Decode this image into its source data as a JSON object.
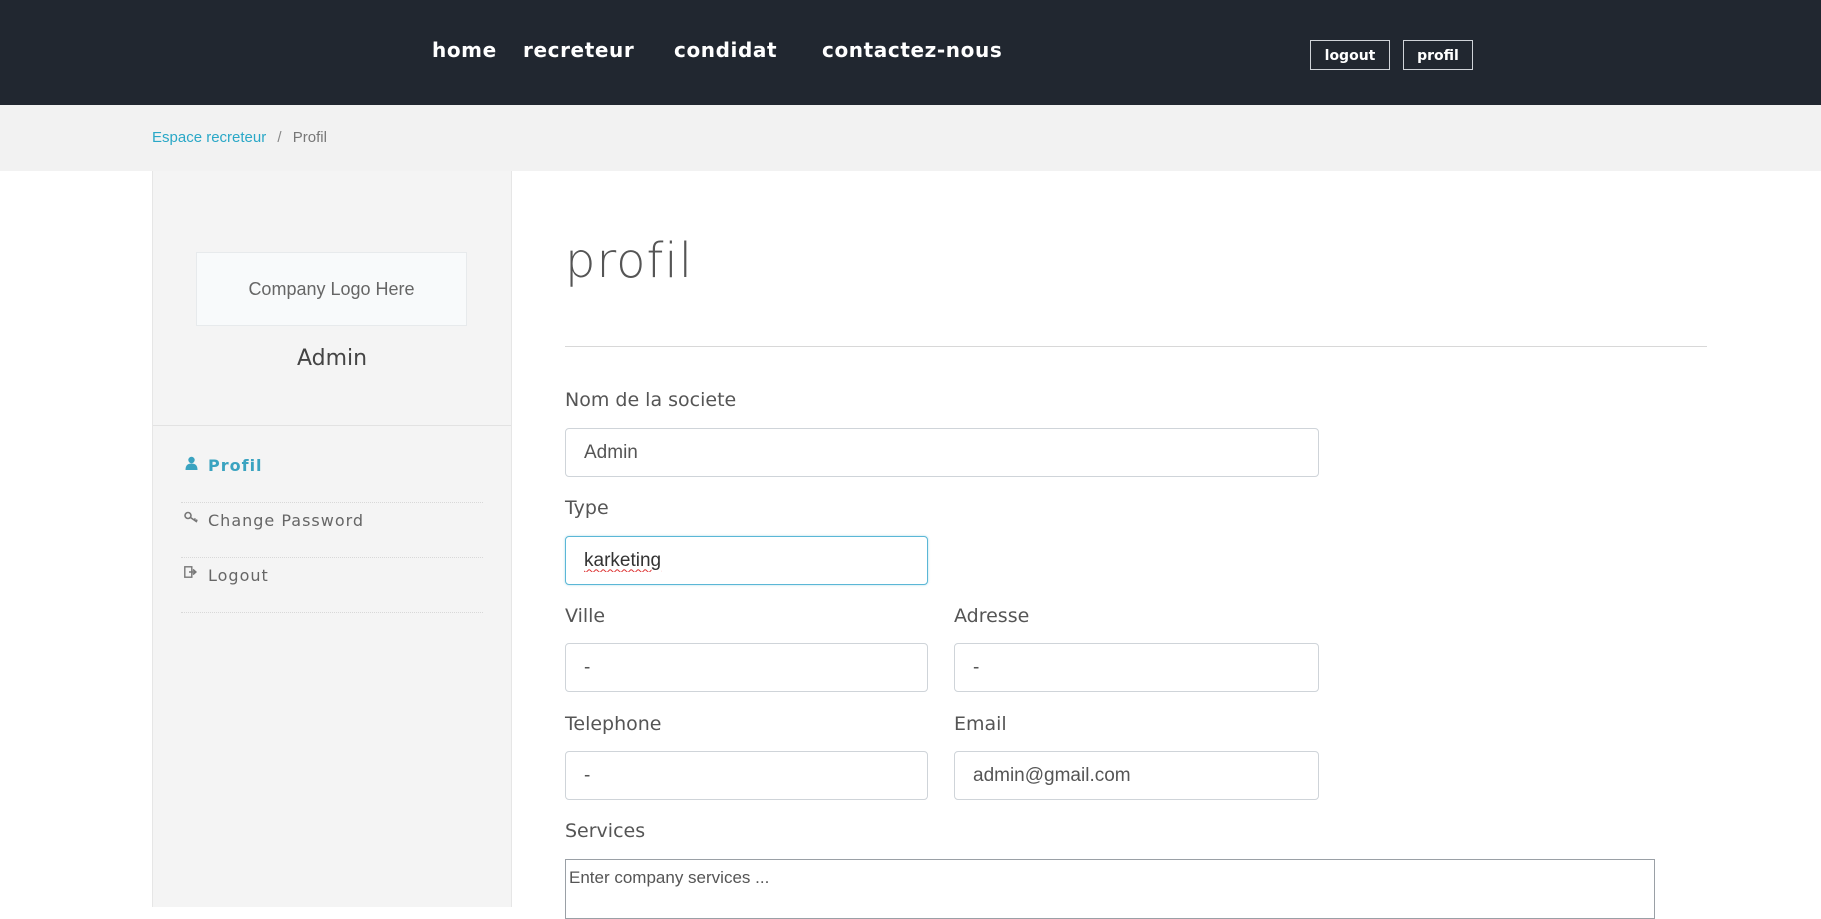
{
  "nav": {
    "links": [
      "home",
      "recreteur",
      "condidat",
      "contactez-nous"
    ],
    "logout_label": "logout",
    "profil_label": "profil"
  },
  "breadcrumb": {
    "parent": "Espace recreteur",
    "separator": "/",
    "current": "Profil"
  },
  "sidebar": {
    "logo_text": "Company Logo Here",
    "user_name": "Admin",
    "menu": [
      {
        "label": "Profil",
        "icon": "user-icon",
        "active": true
      },
      {
        "label": "Change Password",
        "icon": "key-icon",
        "active": false
      },
      {
        "label": "Logout",
        "icon": "logout-icon",
        "active": false
      }
    ]
  },
  "form": {
    "title": "profil",
    "company_name": {
      "label": "Nom de la societe",
      "value": "Admin"
    },
    "type": {
      "label": "Type",
      "value": "karketing"
    },
    "ville": {
      "label": "Ville",
      "value": "-"
    },
    "adresse": {
      "label": "Adresse",
      "value": "-"
    },
    "telephone": {
      "label": "Telephone",
      "value": "-"
    },
    "email": {
      "label": "Email",
      "value": "admin@gmail.com"
    },
    "services": {
      "label": "Services",
      "placeholder": "Enter company services ..."
    }
  },
  "colors": {
    "topbar": "#212730",
    "accent": "#2aa8c7",
    "breadcrumb_bg": "#f2f2f2",
    "sidebar_bg": "#f4f4f4"
  }
}
